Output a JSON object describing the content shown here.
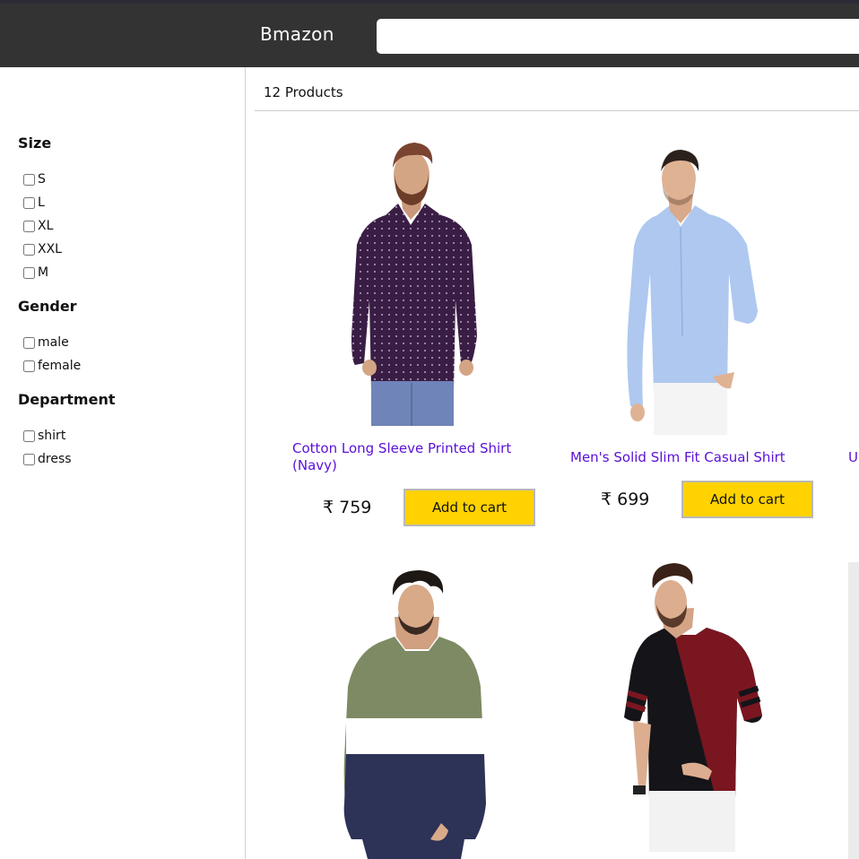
{
  "header": {
    "brand": "Bmazon",
    "search_value": ""
  },
  "filters": {
    "size": {
      "title": "Size",
      "options": [
        "S",
        "L",
        "XL",
        "XXL",
        "M"
      ]
    },
    "gender": {
      "title": "Gender",
      "options": [
        "male",
        "female"
      ]
    },
    "department": {
      "title": "Department",
      "options": [
        "shirt",
        "dress"
      ]
    }
  },
  "results": {
    "count": "12 Products"
  },
  "products": [
    {
      "title": "Cotton Long Sleeve Printed Shirt (Navy)",
      "price": "₹ 759",
      "button": "Add to cart"
    },
    {
      "title": "Men's Solid Slim Fit Casual Shirt",
      "price": "₹ 699",
      "button": "Add to cart"
    },
    {
      "title": "U"
    }
  ],
  "colors": {
    "header_bg": "#333333",
    "accent_button": "#ffd200",
    "product_link": "#5a10d8"
  }
}
